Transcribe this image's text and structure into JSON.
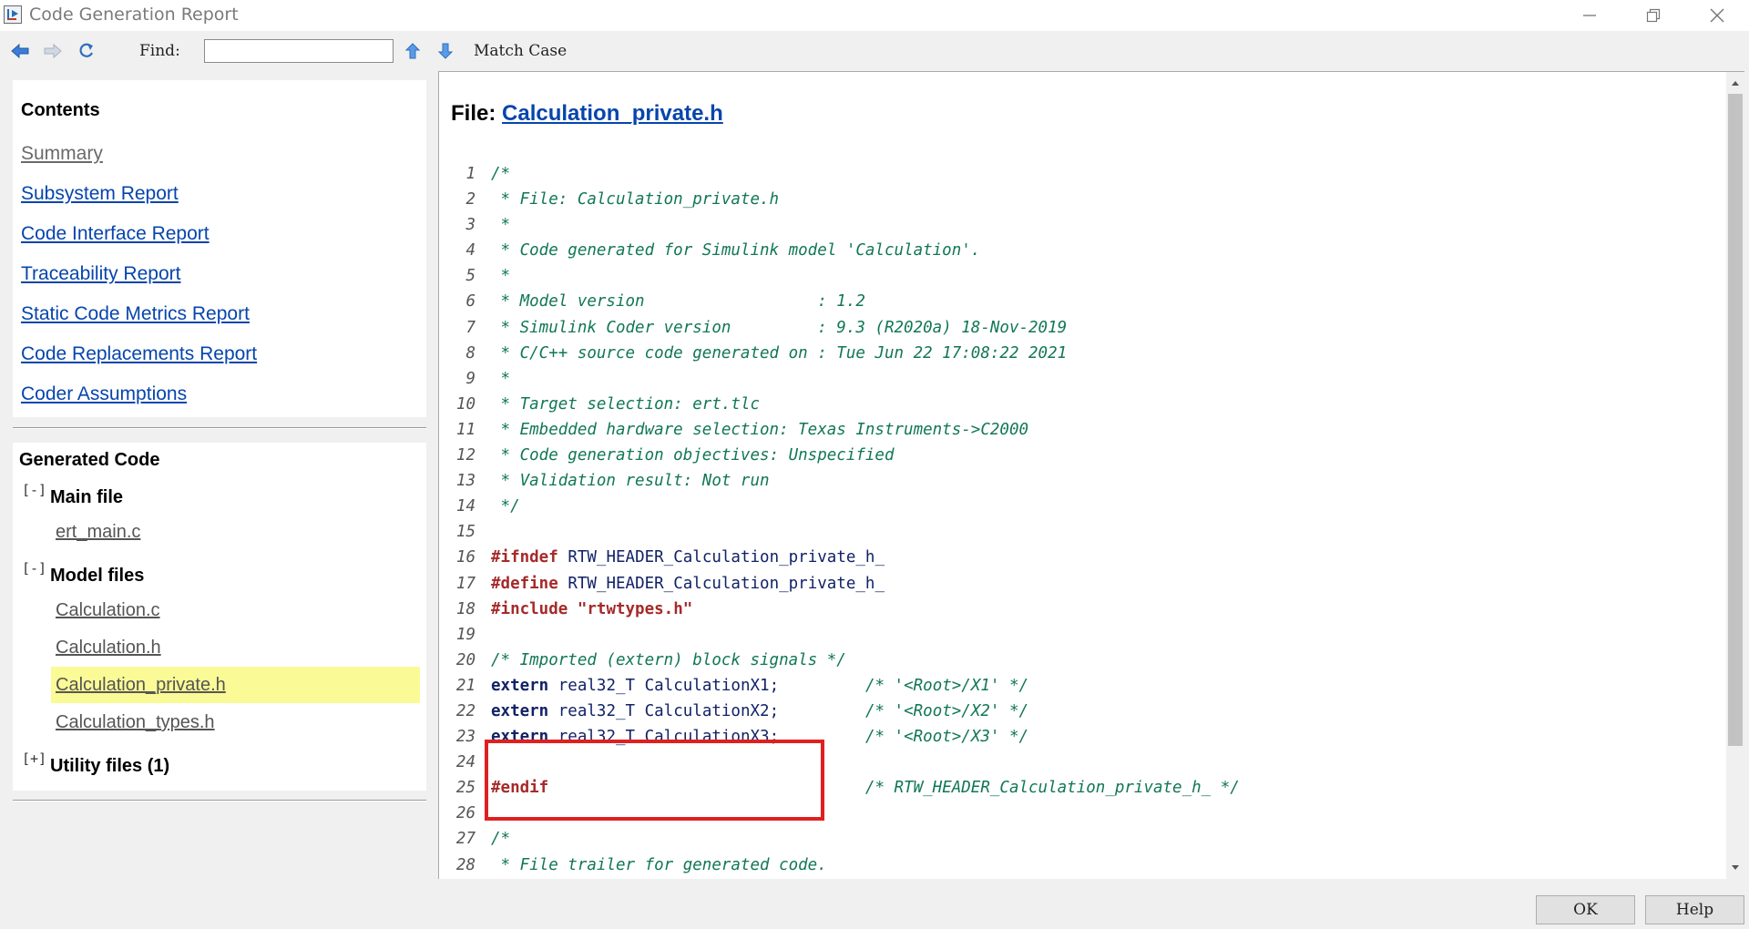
{
  "window": {
    "title": "Code Generation Report"
  },
  "toolbar": {
    "find_label": "Find:",
    "find_value": "",
    "match_case_label": "Match Case"
  },
  "contents": {
    "title": "Contents",
    "links": [
      {
        "label": "Summary",
        "visited": true
      },
      {
        "label": "Subsystem Report",
        "visited": false
      },
      {
        "label": "Code Interface Report",
        "visited": false
      },
      {
        "label": "Traceability Report",
        "visited": false
      },
      {
        "label": "Static Code Metrics Report",
        "visited": false
      },
      {
        "label": "Code Replacements Report",
        "visited": false
      },
      {
        "label": "Coder Assumptions",
        "visited": false
      }
    ]
  },
  "generated_code": {
    "title": "Generated Code",
    "groups": [
      {
        "expander": "[-]",
        "label": "Main file",
        "files": [
          "ert_main.c"
        ]
      },
      {
        "expander": "[-]",
        "label": "Model files",
        "files": [
          "Calculation.c",
          "Calculation.h",
          "Calculation_private.h",
          "Calculation_types.h"
        ],
        "selected": "Calculation_private.h"
      },
      {
        "expander": "[+]",
        "label": "Utility files (1)",
        "files": []
      }
    ]
  },
  "file_view": {
    "prefix": "File: ",
    "file_name": "Calculation_private.h",
    "lines": [
      "/*",
      " * File: Calculation_private.h",
      " *",
      " * Code generated for Simulink model 'Calculation'.",
      " *",
      " * Model version                  : 1.2",
      " * Simulink Coder version         : 9.3 (R2020a) 18-Nov-2019",
      " * C/C++ source code generated on : Tue Jun 22 17:08:22 2021",
      " *",
      " * Target selection: ert.tlc",
      " * Embedded hardware selection: Texas Instruments->C2000",
      " * Code generation objectives: Unspecified",
      " * Validation result: Not run",
      " */",
      "",
      "#ifndef RTW_HEADER_Calculation_private_h_",
      "#define RTW_HEADER_Calculation_private_h_",
      "#include \"rtwtypes.h\"",
      "",
      "/* Imported (extern) block signals */",
      "extern real32_T CalculationX1;         /* '<Root>/X1' */",
      "extern real32_T CalculationX2;         /* '<Root>/X2' */",
      "extern real32_T CalculationX3;         /* '<Root>/X3' */",
      "",
      "#endif                                 /* RTW_HEADER_Calculation_private_h_ */",
      "",
      "/*",
      " * File trailer for generated code."
    ]
  },
  "buttons": {
    "ok": "OK",
    "help": "Help"
  },
  "colors": {
    "link": "#0645ad",
    "comment": "#117755",
    "preprocessor": "#a52a2a",
    "highlight": "#fafa96",
    "annotation_box": "#e02020"
  },
  "icons": {
    "back": "arrow-left-icon",
    "forward": "arrow-right-icon",
    "refresh": "refresh-icon",
    "find_up": "arrow-up-icon",
    "find_down": "arrow-down-icon"
  }
}
